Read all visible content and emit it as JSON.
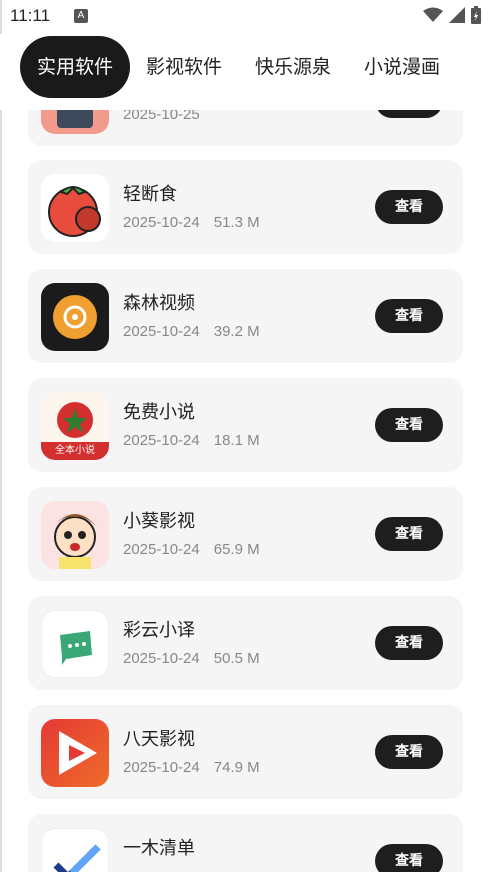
{
  "status": {
    "time": "11:11",
    "notification_badge": "A"
  },
  "tabs": [
    {
      "label": "实用软件",
      "active": true
    },
    {
      "label": "影视软件",
      "active": false
    },
    {
      "label": "快乐源泉",
      "active": false
    },
    {
      "label": "小说漫画",
      "active": false
    }
  ],
  "view_label": "查看",
  "apps": [
    {
      "name": "",
      "date": "2025-10-25",
      "size": ""
    },
    {
      "name": "轻断食",
      "date": "2025-10-24",
      "size": "51.3 M"
    },
    {
      "name": "森林视频",
      "date": "2025-10-24",
      "size": "39.2 M"
    },
    {
      "name": "免费小说",
      "date": "2025-10-24",
      "size": "18.1 M"
    },
    {
      "name": "小葵影视",
      "date": "2025-10-24",
      "size": "65.9 M"
    },
    {
      "name": "彩云小译",
      "date": "2025-10-24",
      "size": "50.5 M"
    },
    {
      "name": "八天影视",
      "date": "2025-10-24",
      "size": "74.9 M"
    },
    {
      "name": "一木清单",
      "date": "",
      "size": ""
    }
  ],
  "icon_texts": {
    "novel_banner": "全本小说"
  },
  "colors": {
    "accent_dark": "#1a1a1a",
    "card_bg": "#f5f5f5"
  }
}
